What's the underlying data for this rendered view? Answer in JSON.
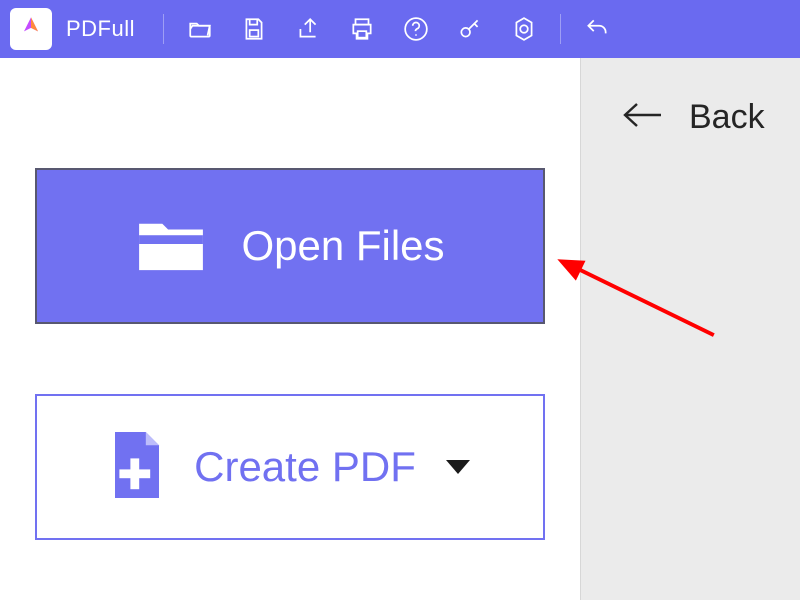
{
  "app": {
    "name": "PDFull"
  },
  "toolbar": {
    "icons": [
      "open-icon",
      "save-icon",
      "share-icon",
      "print-icon",
      "help-icon",
      "key-icon",
      "settings-icon",
      "undo-icon"
    ]
  },
  "main": {
    "open_label": "Open Files",
    "create_label": "Create PDF"
  },
  "sidepanel": {
    "back_label": "Back"
  },
  "colors": {
    "accent": "#6a6af0",
    "accent_light": "#7171f1",
    "panel": "#ebebeb",
    "annotation": "#ff0000"
  }
}
